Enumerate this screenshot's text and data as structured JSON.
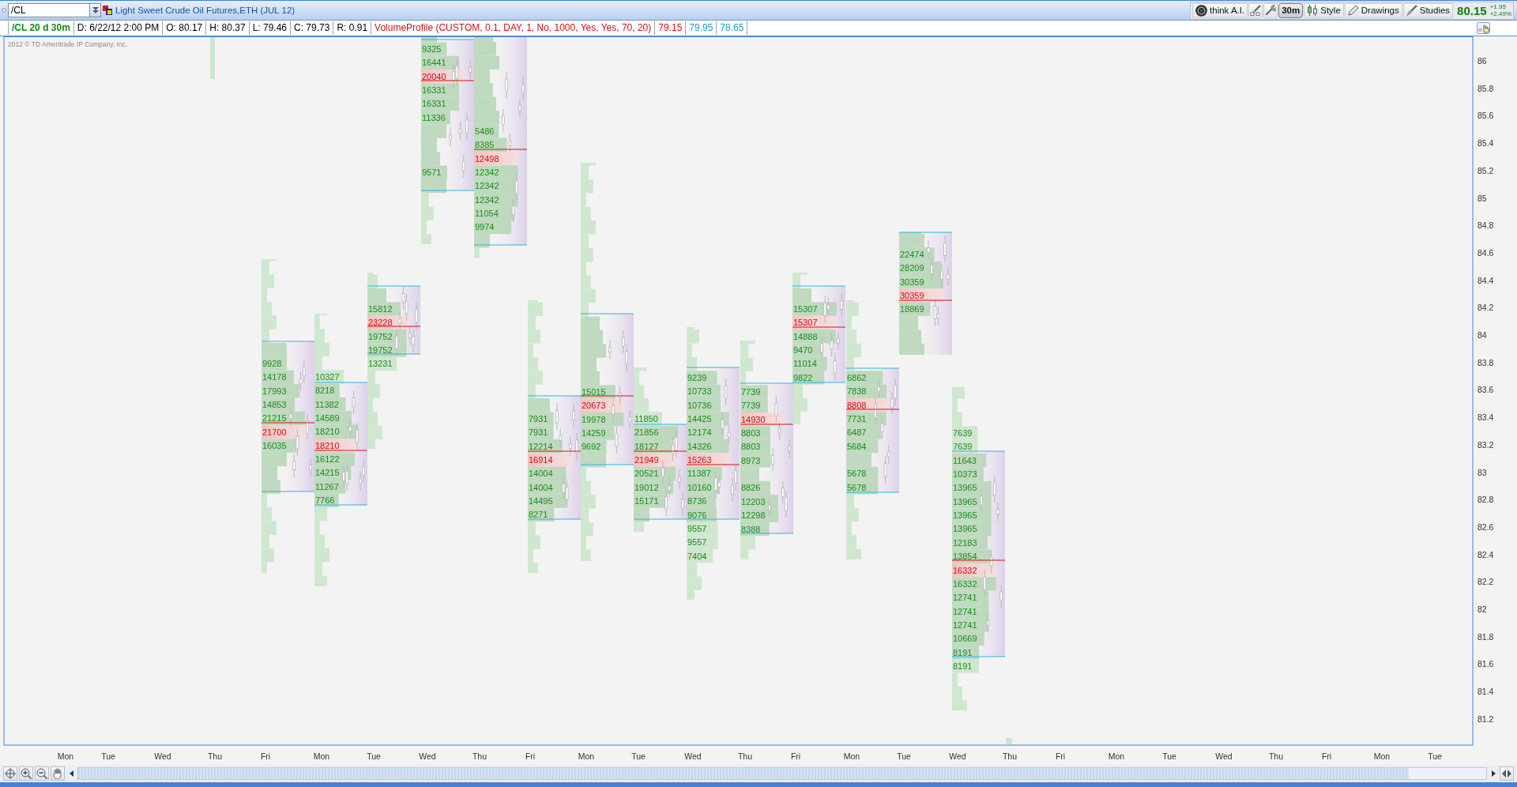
{
  "toolbar": {
    "symbol": "/CL",
    "title": "Light Sweet Crude Oil Futures,ETH (JUL 12)",
    "buttons": [
      {
        "label": "think A.I.",
        "kind": "icon"
      },
      {
        "label": "30m",
        "kind": "period"
      },
      {
        "label": "Style",
        "kind": "icon"
      },
      {
        "label": "Drawings",
        "kind": "icon"
      },
      {
        "label": "Studies",
        "kind": "icon"
      }
    ],
    "quote": {
      "last": "80.15",
      "change": "+1.95",
      "change_percent": "+2.49%"
    }
  },
  "info_bar": {
    "items": [
      {
        "text": "/CL 20 d 30m",
        "kind": "symbol",
        "color": "#138a13"
      },
      {
        "text": "D: 6/22/12 2:00 PM",
        "kind": "field",
        "color": "#000000"
      },
      {
        "text": "O: 80.17",
        "kind": "field",
        "color": "#000000"
      },
      {
        "text": "H: 80.37",
        "kind": "field",
        "color": "#000000"
      },
      {
        "text": "L: 79.46",
        "kind": "field",
        "color": "#000000"
      },
      {
        "text": "C: 79.73",
        "kind": "field",
        "color": "#000000"
      },
      {
        "text": "R: 0.91",
        "kind": "field",
        "color": "#000000"
      },
      {
        "text": "VolumeProfile (CUSTOM, 0.1, DAY, 1, No, 1000, Yes, Yes, 70, 20)",
        "kind": "field",
        "color": "#cc1111"
      },
      {
        "text": "79.15",
        "kind": "field",
        "color": "#cc1111"
      },
      {
        "text": "79.95",
        "kind": "field",
        "color": "#149fc2"
      },
      {
        "text": "78.65",
        "kind": "field",
        "color": "#149fc2"
      }
    ]
  },
  "chart": {
    "copyright": "2012 © TD Ameritrade IP Company, Inc.",
    "price_axis": [
      "86",
      "85.8",
      "85.6",
      "85.4",
      "85.2",
      "85",
      "84.8",
      "84.6",
      "84.4",
      "84.2",
      "84",
      "83.8",
      "83.6",
      "83.4",
      "83.2",
      "83",
      "82.8",
      "82.6",
      "82.4",
      "82.2",
      "82",
      "81.8",
      "81.6",
      "81.4",
      "81.2"
    ],
    "time_axis": [
      "Mon",
      "Tue",
      "Wed",
      "Thu",
      "Fri",
      "Mon",
      "Tue",
      "Wed",
      "Thu",
      "Fri",
      "Mon",
      "Tue",
      "Wed",
      "Thu",
      "Fri",
      "Mon",
      "Tue",
      "Wed",
      "Thu",
      "Fri",
      "Mon",
      "Tue",
      "Wed",
      "Thu",
      "Fri",
      "Mon",
      "Tue"
    ],
    "profiles": [
      {
        "values": [
          {
            "text": "9928",
            "poc": false
          },
          {
            "text": "14178",
            "poc": false
          },
          {
            "text": "17993",
            "poc": false
          },
          {
            "text": "14853",
            "poc": false
          },
          {
            "text": "21215",
            "poc": false
          },
          {
            "text": "21700",
            "poc": true
          },
          {
            "text": "16035",
            "poc": false
          }
        ]
      },
      {
        "values": [
          {
            "text": "10327",
            "poc": false
          },
          {
            "text": "8218",
            "poc": false
          },
          {
            "text": "11382",
            "poc": false
          },
          {
            "text": "14589",
            "poc": false
          },
          {
            "text": "18210",
            "poc": false
          },
          {
            "text": "18210",
            "poc": true
          },
          {
            "text": "16122",
            "poc": false
          },
          {
            "text": "14215",
            "poc": false
          },
          {
            "text": "11267",
            "poc": false
          },
          {
            "text": "7766",
            "poc": false
          }
        ]
      },
      {
        "values": [
          {
            "text": "15812",
            "poc": false
          },
          {
            "text": "23228",
            "poc": true
          },
          {
            "text": "19752",
            "poc": false
          },
          {
            "text": "19752",
            "poc": false
          },
          {
            "text": "13231",
            "poc": false
          }
        ]
      },
      {
        "values": [
          {
            "text": "9325",
            "poc": false
          },
          {
            "text": "16441",
            "poc": false
          },
          {
            "text": "20040",
            "poc": true
          },
          {
            "text": "16331",
            "poc": false
          },
          {
            "text": "16331",
            "poc": false
          },
          {
            "text": "11336",
            "poc": false
          },
          {
            "text": "9571",
            "poc": false
          }
        ]
      },
      {
        "values": [
          {
            "text": "5486",
            "poc": false
          },
          {
            "text": "8385",
            "poc": false
          },
          {
            "text": "12498",
            "poc": true
          },
          {
            "text": "12342",
            "poc": false
          },
          {
            "text": "12342",
            "poc": false
          },
          {
            "text": "12342",
            "poc": false
          },
          {
            "text": "11054",
            "poc": false
          },
          {
            "text": "9974",
            "poc": false
          }
        ]
      },
      {
        "values": [
          {
            "text": "7931",
            "poc": false
          },
          {
            "text": "7931",
            "poc": false
          },
          {
            "text": "12214",
            "poc": false
          },
          {
            "text": "16914",
            "poc": true
          },
          {
            "text": "14004",
            "poc": false
          },
          {
            "text": "14004",
            "poc": false
          },
          {
            "text": "14495",
            "poc": false
          },
          {
            "text": "8271",
            "poc": false
          }
        ]
      },
      {
        "values": [
          {
            "text": "15015",
            "poc": false
          },
          {
            "text": "20673",
            "poc": true
          },
          {
            "text": "19978",
            "poc": false
          },
          {
            "text": "14259",
            "poc": false
          },
          {
            "text": "9692",
            "poc": false
          }
        ]
      },
      {
        "values": [
          {
            "text": "11850",
            "poc": false
          },
          {
            "text": "21856",
            "poc": false
          },
          {
            "text": "18127",
            "poc": false
          },
          {
            "text": "21949",
            "poc": true
          },
          {
            "text": "20521",
            "poc": false
          },
          {
            "text": "19012",
            "poc": false
          },
          {
            "text": "15171",
            "poc": false
          }
        ]
      },
      {
        "values": [
          {
            "text": "9239",
            "poc": false
          },
          {
            "text": "10733",
            "poc": false
          },
          {
            "text": "10736",
            "poc": false
          },
          {
            "text": "14425",
            "poc": false
          },
          {
            "text": "12174",
            "poc": false
          },
          {
            "text": "14326",
            "poc": false
          },
          {
            "text": "15263",
            "poc": true
          },
          {
            "text": "11387",
            "poc": false
          },
          {
            "text": "10160",
            "poc": false
          },
          {
            "text": "8736",
            "poc": false
          },
          {
            "text": "9076",
            "poc": false
          },
          {
            "text": "9557",
            "poc": false
          },
          {
            "text": "9557",
            "poc": false
          },
          {
            "text": "7404",
            "poc": false
          }
        ]
      },
      {
        "values": [
          {
            "text": "7739",
            "poc": false
          },
          {
            "text": "7739",
            "poc": false
          },
          {
            "text": "14930",
            "poc": true
          },
          {
            "text": "8803",
            "poc": false
          },
          {
            "text": "8803",
            "poc": false
          },
          {
            "text": "8973",
            "poc": false
          },
          {
            "text": "8826",
            "poc": false
          },
          {
            "text": "12203",
            "poc": false
          },
          {
            "text": "12298",
            "poc": false
          },
          {
            "text": "8388",
            "poc": false
          }
        ]
      },
      {
        "values": [
          {
            "text": "15307",
            "poc": false
          },
          {
            "text": "15307",
            "poc": true
          },
          {
            "text": "14888",
            "poc": false
          },
          {
            "text": "9470",
            "poc": false
          },
          {
            "text": "11014",
            "poc": false
          },
          {
            "text": "9822",
            "poc": false
          }
        ]
      },
      {
        "values": [
          {
            "text": "6862",
            "poc": false
          },
          {
            "text": "7838",
            "poc": false
          },
          {
            "text": "8808",
            "poc": true
          },
          {
            "text": "7731",
            "poc": false
          },
          {
            "text": "6487",
            "poc": false
          },
          {
            "text": "5684",
            "poc": false
          },
          {
            "text": "5678",
            "poc": false
          },
          {
            "text": "5678",
            "poc": false
          }
        ]
      },
      {
        "values": [
          {
            "text": "22474",
            "poc": false
          },
          {
            "text": "28209",
            "poc": false
          },
          {
            "text": "30359",
            "poc": false
          },
          {
            "text": "30359",
            "poc": true
          },
          {
            "text": "18869",
            "poc": false
          }
        ]
      },
      {
        "values": [
          {
            "text": "7639",
            "poc": false
          },
          {
            "text": "7639",
            "poc": false
          },
          {
            "text": "11643",
            "poc": false
          },
          {
            "text": "10373",
            "poc": false
          },
          {
            "text": "13965",
            "poc": false
          },
          {
            "text": "13965",
            "poc": false
          },
          {
            "text": "13965",
            "poc": false
          },
          {
            "text": "13965",
            "poc": false
          },
          {
            "text": "12183",
            "poc": false
          },
          {
            "text": "13854",
            "poc": false
          },
          {
            "text": "16332",
            "poc": true
          },
          {
            "text": "16332",
            "poc": false
          },
          {
            "text": "12741",
            "poc": false
          },
          {
            "text": "12741",
            "poc": false
          },
          {
            "text": "12741",
            "poc": false
          },
          {
            "text": "10669",
            "poc": false
          },
          {
            "text": "8191",
            "poc": false
          },
          {
            "text": "8191",
            "poc": false
          }
        ]
      }
    ]
  }
}
